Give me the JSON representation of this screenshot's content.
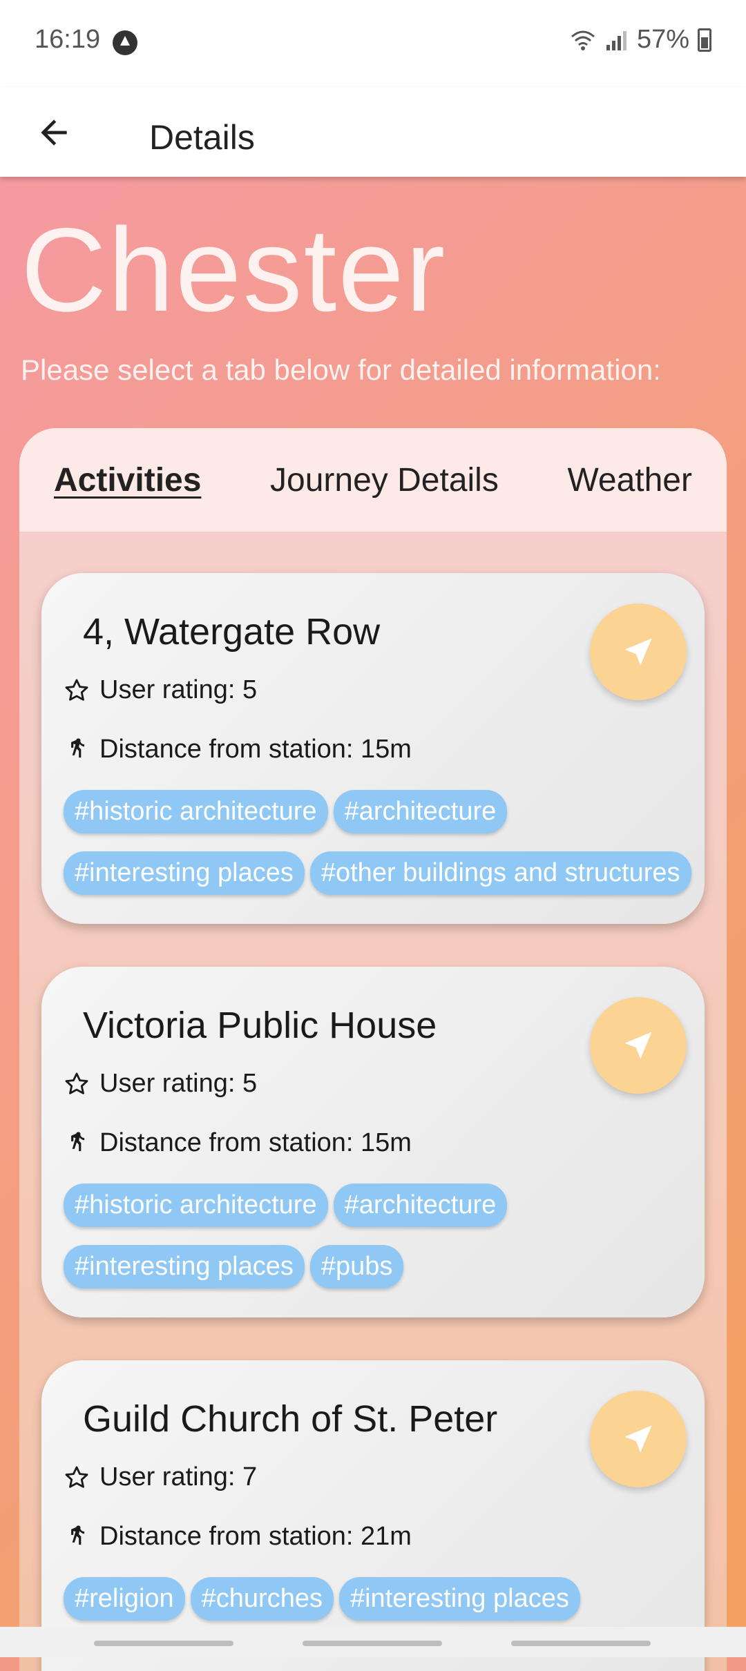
{
  "status_bar": {
    "time": "16:19",
    "battery": "57%"
  },
  "app_bar": {
    "title": "Details"
  },
  "hero": {
    "city": "Chester",
    "subtitle": "Please select a tab below for detailed information:"
  },
  "tabs": [
    {
      "label": "Activities",
      "active": true
    },
    {
      "label": "Journey Details",
      "active": false
    },
    {
      "label": "Weather",
      "active": false
    }
  ],
  "activities": [
    {
      "title": "4, Watergate Row",
      "rating": "User rating: 5",
      "distance": "Distance from station: 15m",
      "tags": [
        "#historic architecture",
        "#architecture",
        "#interesting places",
        "#other buildings and structures"
      ]
    },
    {
      "title": "Victoria Public House",
      "rating": "User rating: 5",
      "distance": "Distance from station: 15m",
      "tags": [
        "#historic architecture",
        "#architecture",
        "#interesting places",
        "#pubs"
      ]
    },
    {
      "title": "Guild Church of St. Peter",
      "rating": "User rating: 7",
      "distance": "Distance from station: 21m",
      "tags": [
        "#religion",
        "#churches",
        "#interesting places"
      ]
    }
  ],
  "colors": {
    "nav_button": "#fbd494",
    "tag": "#8fc8f4"
  }
}
